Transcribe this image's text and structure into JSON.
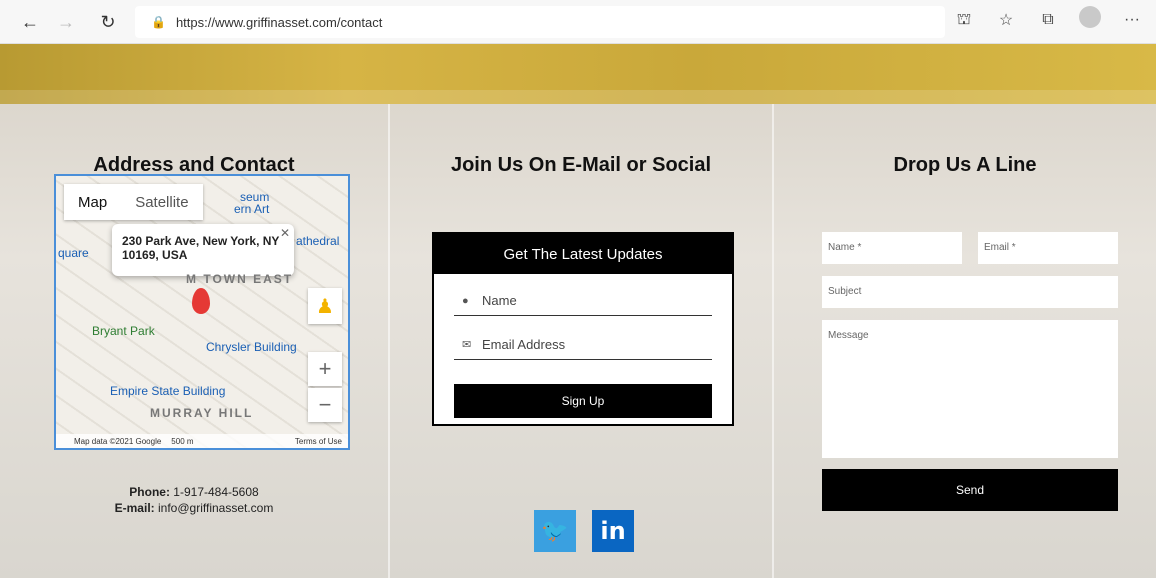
{
  "browser": {
    "url": "https://www.griffinasset.com/contact",
    "back_icon": "←",
    "forward_icon": "→",
    "refresh_icon": "↻",
    "lock_icon": "🔒",
    "reader_icon": "⛫",
    "favorites_icon": "☆",
    "collections_icon": "⧉",
    "more_icon": "···"
  },
  "columns": {
    "left": {
      "title": "Address and Contact"
    },
    "middle": {
      "title": "Join Us On E-Mail or Social"
    },
    "right": {
      "title": "Drop Us A Line"
    }
  },
  "map": {
    "tabs": [
      "Map",
      "Satellite"
    ],
    "popup_address": "230 Park Ave, New York, NY 10169, USA",
    "labels": {
      "museum": "seum",
      "art": "ern Art",
      "cathedral": "athedral",
      "square": "quare",
      "midtown": "M TOWN EAST",
      "bryant": "Bryant Park",
      "chrysler": "Chrysler Building",
      "empire": "Empire State Building",
      "murray": "MURRAY HILL"
    },
    "footer": {
      "data": "Map data ©2021 Google",
      "scale": "500 m",
      "terms": "Terms of Use"
    }
  },
  "contact": {
    "phone_label": "Phone:",
    "phone": "1-917-484-5608",
    "email_label": "E-mail:",
    "email": "info@griffinasset.com"
  },
  "newsletter": {
    "heading": "Get The Latest Updates",
    "name_placeholder": "Name",
    "email_placeholder": "Email Address",
    "button": "Sign Up"
  },
  "social": {
    "twitter": "🐦",
    "linkedin": "in"
  },
  "form": {
    "name": "Name *",
    "email": "Email *",
    "subject": "Subject",
    "message": "Message",
    "button": "Send"
  },
  "colors": {
    "banner": "#c9a83a",
    "twitter": "#3aa0e0",
    "linkedin": "#0a66c2"
  }
}
